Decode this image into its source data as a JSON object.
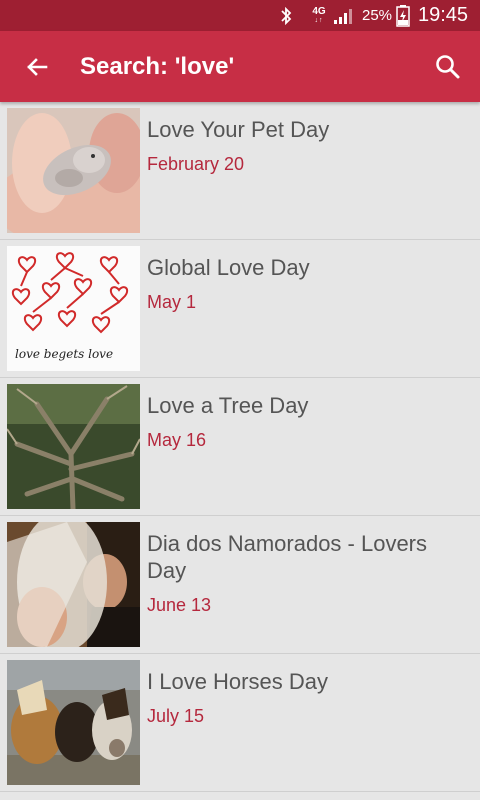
{
  "status_bar": {
    "network": "4G",
    "battery_percent": "25%",
    "time": "19:45",
    "icons": [
      "bluetooth-icon",
      "network-arrows-icon",
      "signal-icon",
      "battery-charging-icon"
    ]
  },
  "app_bar": {
    "title": "Search: 'love'",
    "back_icon": "arrow-left-icon",
    "search_icon": "search-icon"
  },
  "results": [
    {
      "title": "Love Your Pet Day",
      "date": "February 20"
    },
    {
      "title": "Global Love Day",
      "date": "May 1",
      "image_text": "love begets love"
    },
    {
      "title": "Love a Tree Day",
      "date": "May 16"
    },
    {
      "title": "Dia dos Namorados - Lovers Day",
      "date": "June 13"
    },
    {
      "title": "I Love Horses Day",
      "date": "July 15"
    }
  ],
  "colors": {
    "status_bar": "#9e1f32",
    "app_bar": "#c72e45",
    "date_text": "#b5283d",
    "background": "#e6e6e6"
  }
}
